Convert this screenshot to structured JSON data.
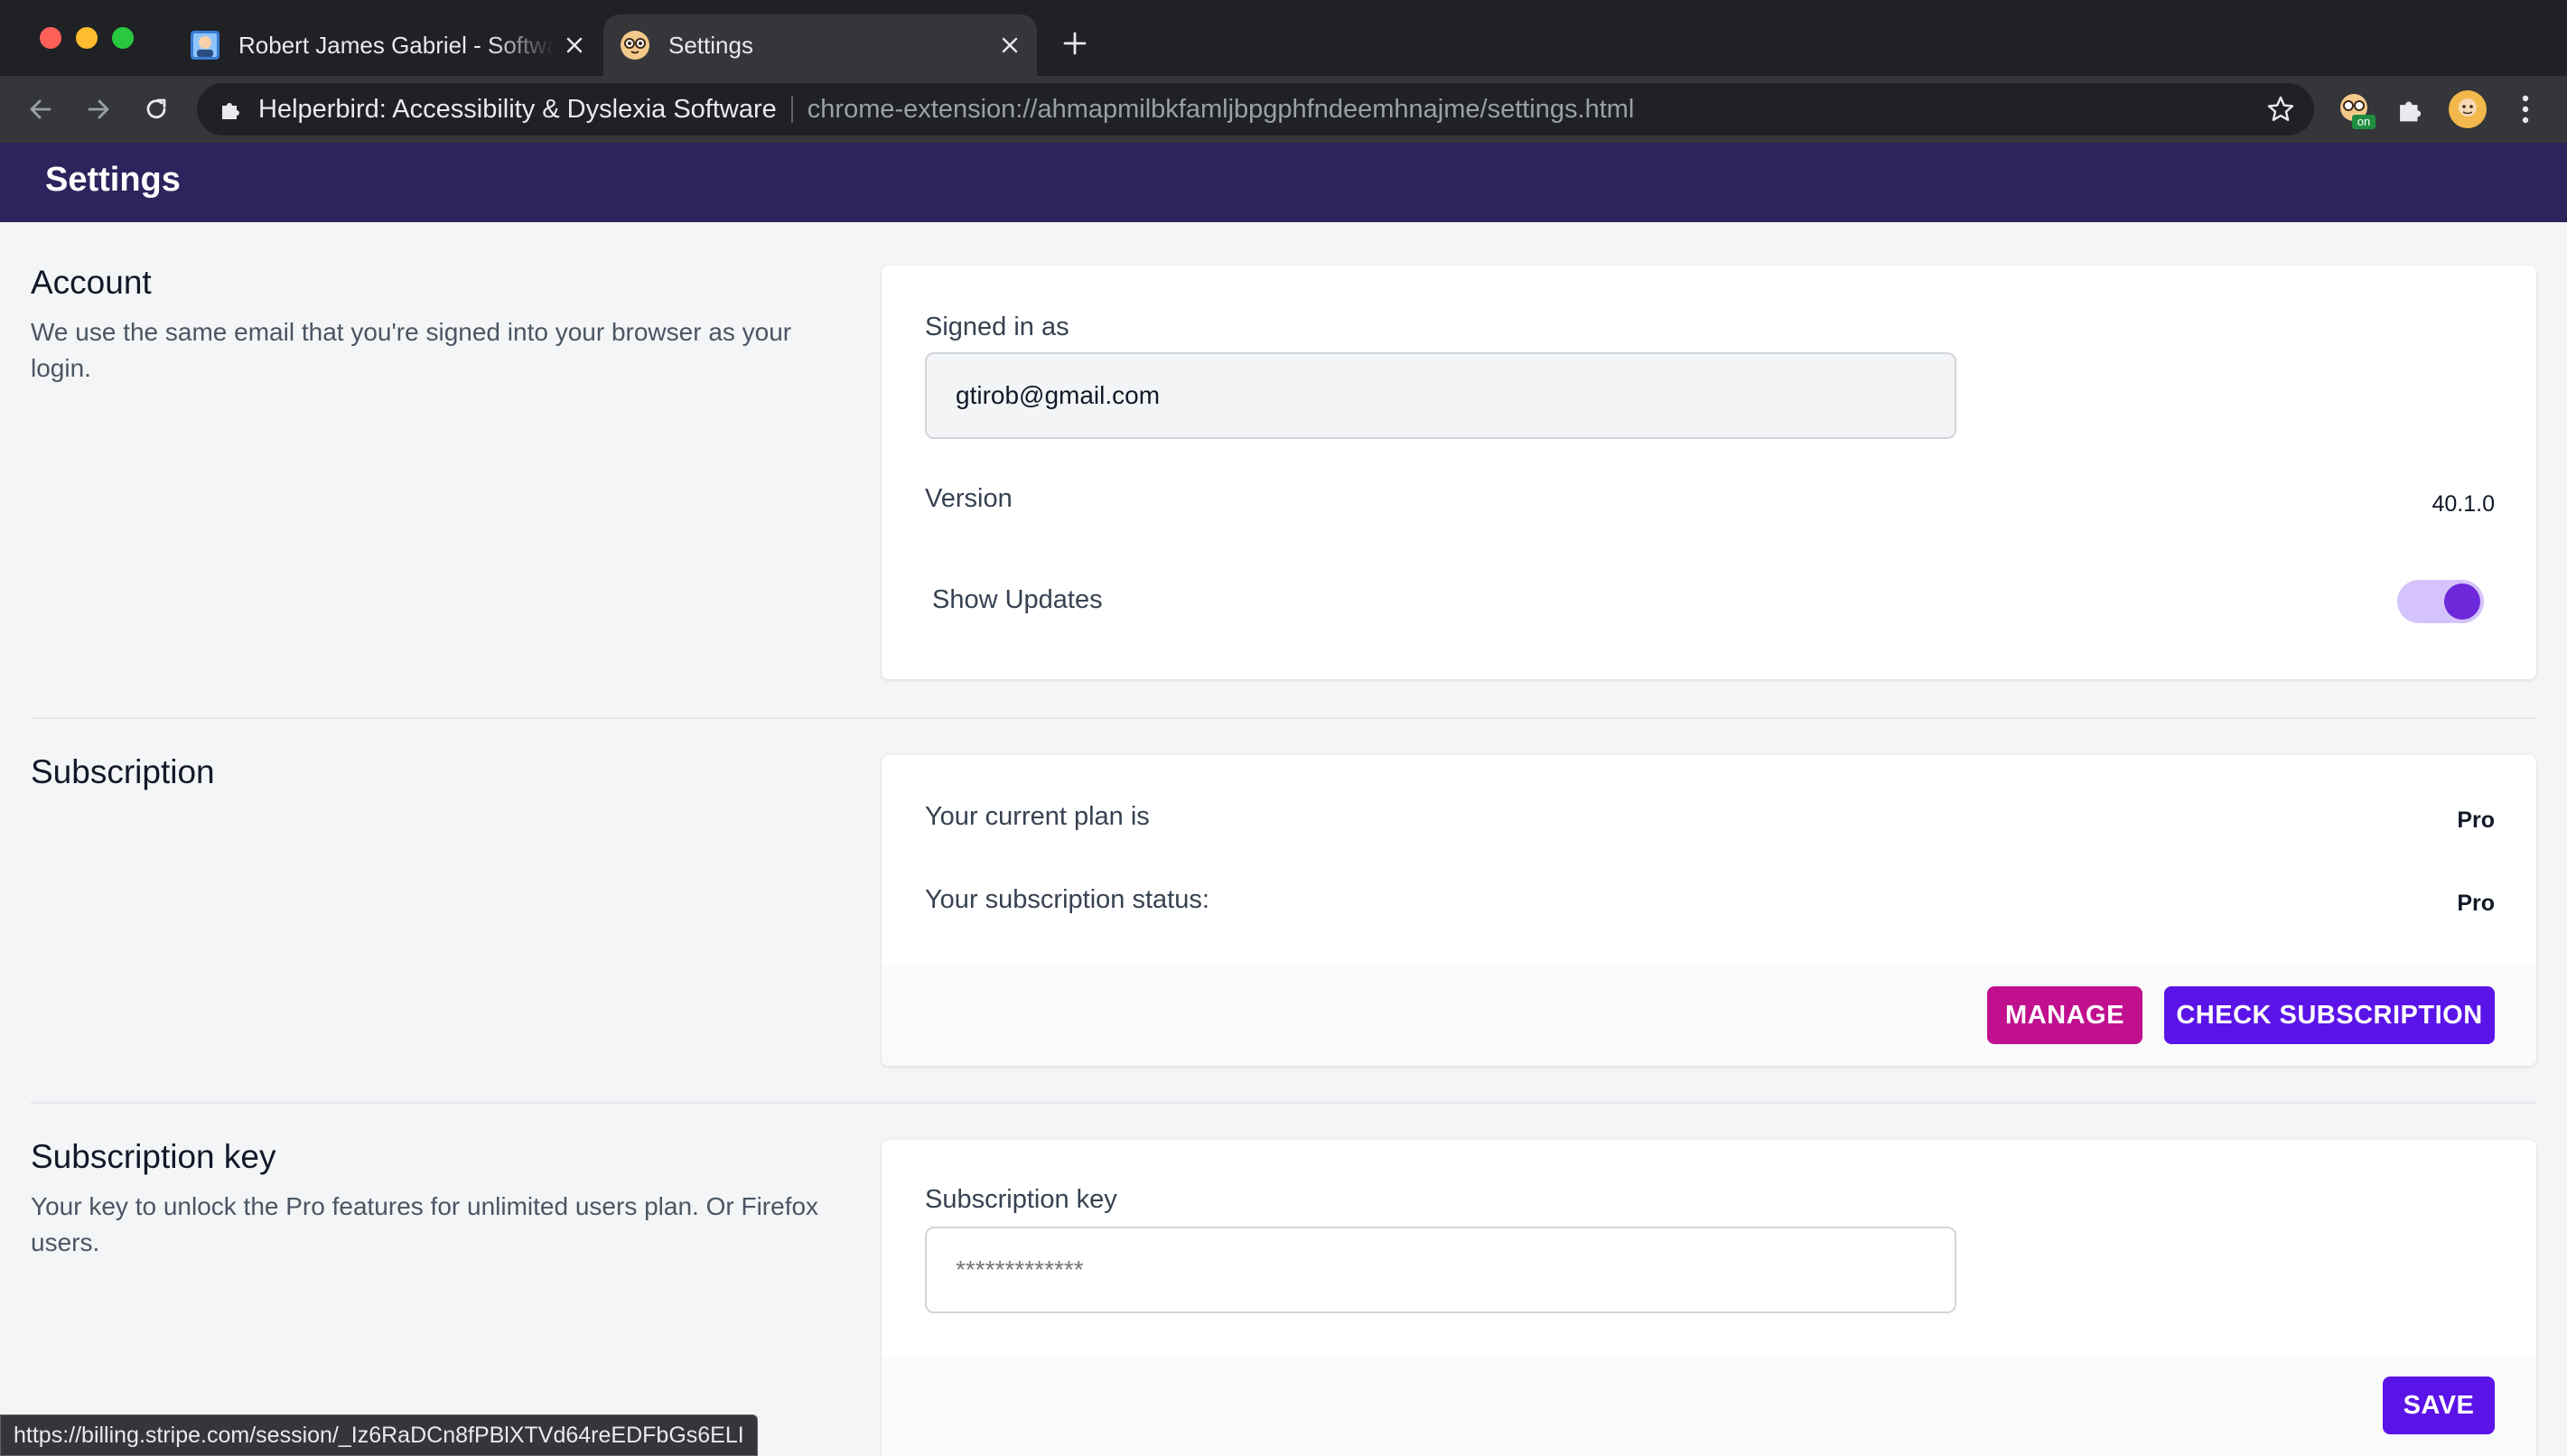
{
  "browser": {
    "tabs": [
      {
        "title": "Robert James Gabriel - Software Developer",
        "active": false
      },
      {
        "title": "Settings",
        "active": true
      }
    ],
    "omnibox": {
      "site_name": "Helperbird: Accessibility & Dyslexia Software",
      "url": "chrome-extension://ahmapmilbkfamljbpgphfndeemhnajme/settings.html"
    },
    "extension_badge": "on",
    "status_url": "https://billing.stripe.com/session/_Iz6RaDCn8fPBlXTVd64reEDFbGs6ELI"
  },
  "header": {
    "title": "Settings"
  },
  "account": {
    "title": "Account",
    "description": "We use the same email that you're signed into your browser as your login.",
    "signed_in_label": "Signed in as",
    "email": "gtirob@gmail.com",
    "version_label": "Version",
    "version_value": "40.1.0",
    "show_updates_label": "Show Updates",
    "show_updates_enabled": true
  },
  "subscription": {
    "title": "Subscription",
    "plan_label": "Your current plan is",
    "plan_value": "Pro",
    "status_label": "Your subscription status:",
    "status_value": "Pro",
    "manage_label": "MANAGE",
    "check_label": "CHECK SUBSCRIPTION"
  },
  "subscription_key": {
    "title": "Subscription key",
    "description": "Your key to unlock the Pro features for unlimited users plan. Or Firefox users.",
    "field_label": "Subscription key",
    "field_placeholder": "*************",
    "save_label": "SAVE"
  },
  "colors": {
    "header_bg": "#2d245e",
    "manage_button": "#c0108e",
    "primary_button": "#5b14e8",
    "toggle_on": "#6d28d9"
  }
}
